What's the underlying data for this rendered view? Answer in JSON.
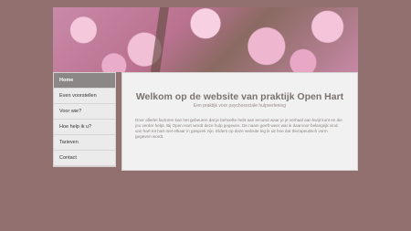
{
  "nav": {
    "items": [
      {
        "label": "Home"
      },
      {
        "label": "Even voorstellen"
      },
      {
        "label": "Voor wie?"
      },
      {
        "label": "Hoe help ik u?"
      },
      {
        "label": "Tarieven"
      },
      {
        "label": "Contact"
      }
    ]
  },
  "content": {
    "title": "Welkom op de website van praktijk Open Hart",
    "subtitle": "Een praktijk voor psychosociale hulpverlening",
    "body": "Door allerlei factoren kan het gebeuren dat je behoefte hebt aan iemand waar je je verhaal aan kwijt kunt en die jou verder helpt. Bij Open Hart wordt deze hulp gegeven. De naam geeft weer wat ik daarvoor belangrijk vind: van hart tot hart met elkaar in gesprek zijn. Elders op deze website leg ik uit hoe dat therapeutisch vorm gegeven wordt."
  }
}
